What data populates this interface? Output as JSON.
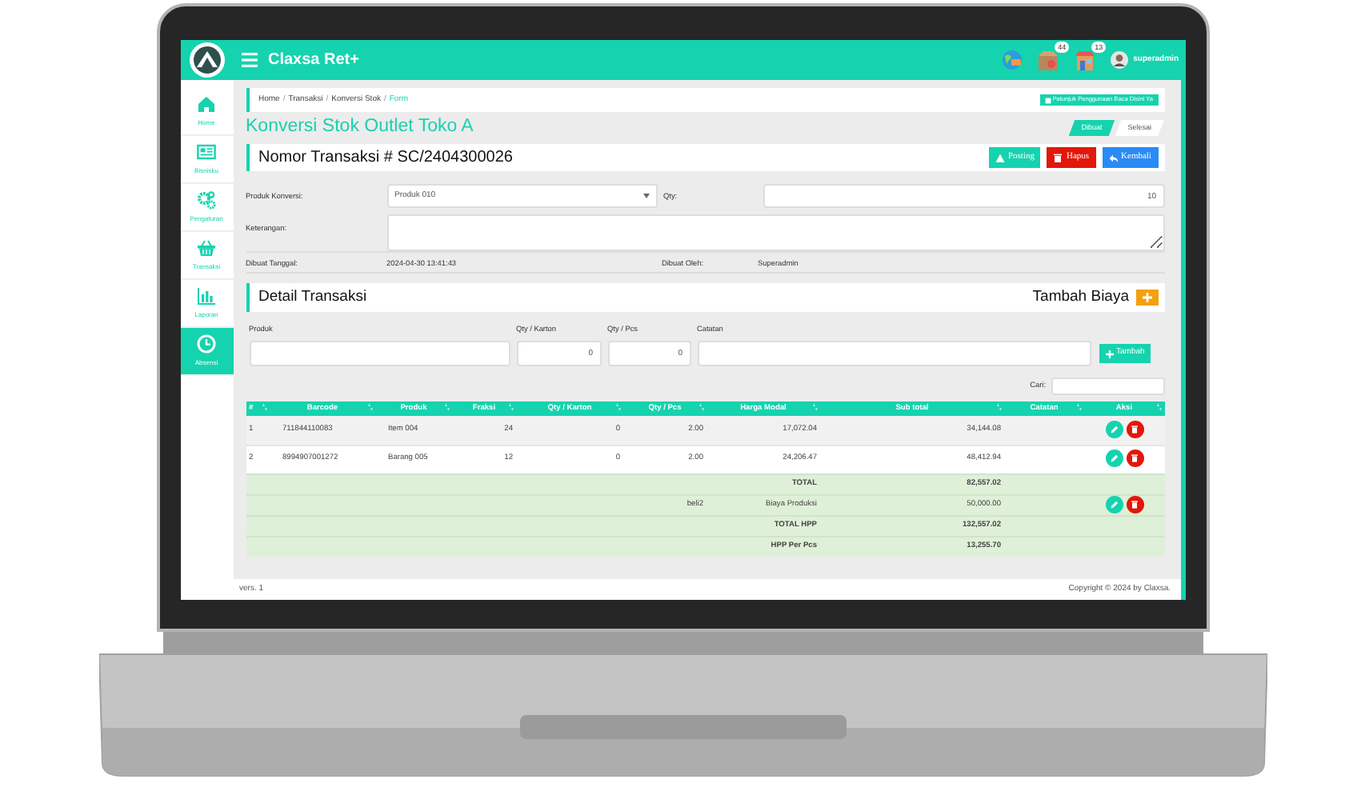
{
  "header": {
    "title": "Claxsa Ret+",
    "notifications": [
      {
        "kind": "box",
        "count": "44"
      },
      {
        "kind": "store",
        "count": "13"
      }
    ],
    "user": "superadmin"
  },
  "sidebar": {
    "items": [
      {
        "kind": "home",
        "label": "Home",
        "selected": false
      },
      {
        "kind": "news",
        "label": "Bisnisku",
        "selected": false
      },
      {
        "kind": "gears",
        "label": "Pengaturan",
        "selected": false
      },
      {
        "kind": "basket",
        "label": "Transaksi",
        "selected": false
      },
      {
        "kind": "chart",
        "label": "Laporan",
        "selected": false
      },
      {
        "kind": "clock",
        "label": "Absensi",
        "selected": true
      }
    ]
  },
  "breadcrumb": [
    {
      "label": "Home",
      "current": false,
      "separator": "/"
    },
    {
      "label": "Transaksi",
      "current": false,
      "separator": "/"
    },
    {
      "label": "Konversi Stok",
      "current": false,
      "separator": "/"
    },
    {
      "label": "Form",
      "current": true
    }
  ],
  "guide_button": "Petunjuk Penggunaan Baca Disini Ya",
  "page_title": "Konversi Stok Outlet Toko A",
  "steps": [
    {
      "label": "Dibuat",
      "selected": true
    },
    {
      "label": "Selesai",
      "selected": false
    }
  ],
  "transaction_title": "Nomor Transaksi # SC/2404300026",
  "actions": [
    {
      "kind": "posting",
      "label": "Posting"
    },
    {
      "kind": "delete",
      "label": "Hapus"
    },
    {
      "kind": "back",
      "label": "Kembali"
    }
  ],
  "form": {
    "product_label": "Produk Konversi:",
    "product_value": "Produk 010",
    "qty_label": "Qty:",
    "qty_value": "10",
    "note_label": "Keterangan:",
    "date_label": "Dibuat Tanggal:",
    "date_value": "2024-04-30 13:41:43",
    "by_label": "Dibuat Oleh:",
    "by_value": "Superadmin"
  },
  "detail": {
    "title": "Detail Transaksi",
    "add_cost_label": "Tambah Biaya",
    "entry_fields": [
      {
        "label": "Produk"
      },
      {
        "label": "Qty / Karton",
        "value": "0"
      },
      {
        "label": "Qty / Pcs",
        "value": "0"
      },
      {
        "label": "Catatan"
      }
    ],
    "add_button": "Tambah",
    "search_label": "Cari:"
  },
  "table": {
    "columns": [
      "#",
      "Barcode",
      "Produk",
      "Fraksi",
      "Qty / Karton",
      "Qty / Pcs",
      "Harga Modal",
      "Sub total",
      "Catatan",
      "Aksi"
    ],
    "rows": [
      {
        "no": "1",
        "barcode": "711844110083",
        "product": "Item 004",
        "fraction": "24",
        "qty_carton": "0",
        "qty_pcs": "2.00",
        "cost": "17,072.04",
        "subtotal": "34,144.08"
      },
      {
        "no": "2",
        "barcode": "8994907001272",
        "product": "Barang 005",
        "fraction": "12",
        "qty_carton": "0",
        "qty_pcs": "2.00",
        "cost": "24,206.47",
        "subtotal": "48,412.94"
      }
    ],
    "summary": [
      {
        "kind": "total",
        "label": "TOTAL",
        "value": "82,557.02"
      },
      {
        "kind": "cost",
        "code": "beli2",
        "label": "Biaya Produksi",
        "value": "50,000.00"
      },
      {
        "kind": "total",
        "label": "TOTAL HPP",
        "value": "132,557.02"
      },
      {
        "kind": "total",
        "label": "HPP Per Pcs",
        "value": "13,255.70"
      }
    ]
  },
  "footer": {
    "version": "vers. 1",
    "copyright": "Copyright © 2024 by",
    "link": "Claxsa."
  }
}
